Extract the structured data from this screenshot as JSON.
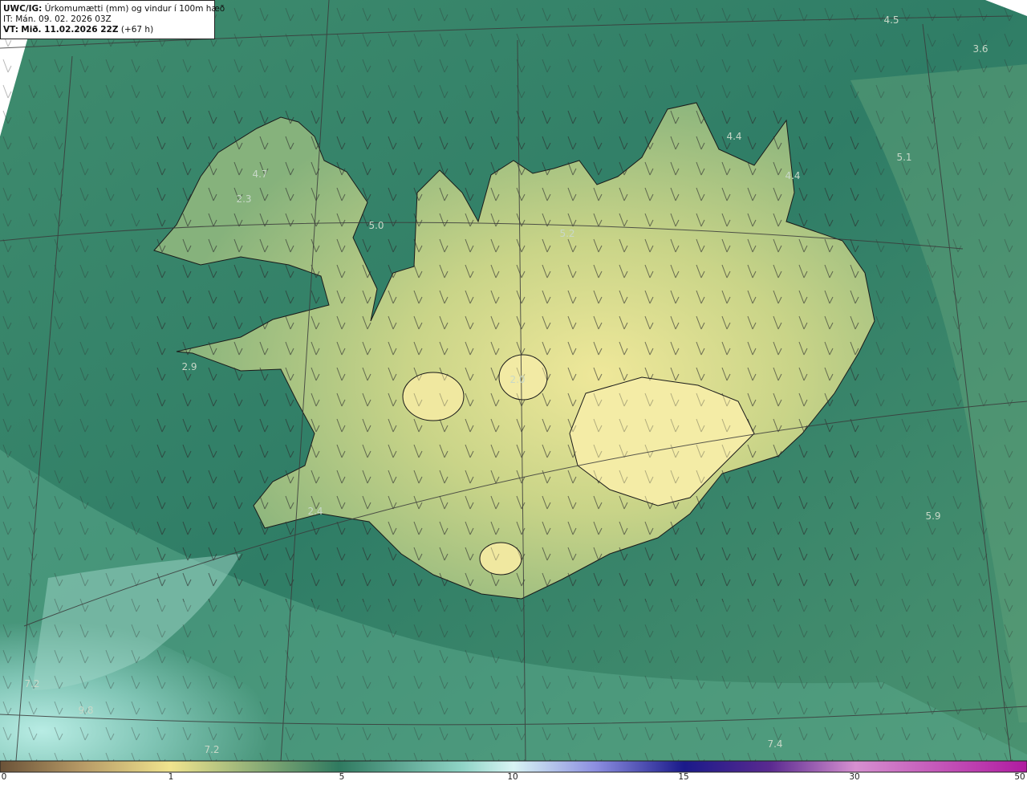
{
  "header": {
    "product_label": "UWC/IG:",
    "title": "Úrkomumætti (mm) og vindur í 100m hæð",
    "issue_time": "IT: Mán. 09. 02. 2026 03Z",
    "valid_label": "VT:",
    "valid_time": "Mið. 11.02.2026 22Z",
    "valid_offset": "(+67 h)"
  },
  "value_labels": [
    "4.5",
    "3.6",
    "4.4",
    "4.4",
    "5.1",
    "4.7",
    "2.3",
    "5.0",
    "5.2",
    "2.9",
    "2.0",
    "2.4",
    "5.9",
    "7.2",
    "9.8",
    "7.2",
    "7.4"
  ],
  "colorbar": {
    "ticks": [
      "0",
      "1",
      "5",
      "10",
      "15",
      "30",
      "50"
    ],
    "tick_values": [
      0,
      1,
      5,
      10,
      15,
      30,
      50
    ]
  },
  "colors": {
    "ocean_deep": "#2e7a64",
    "ocean_mid": "#4c9a7c",
    "land_low": "#7fb07a",
    "land_high": "#e8e494",
    "light_water": "#9ed8cf",
    "coastline": "#1a1a1a",
    "graticule": "#3a3a3a"
  }
}
